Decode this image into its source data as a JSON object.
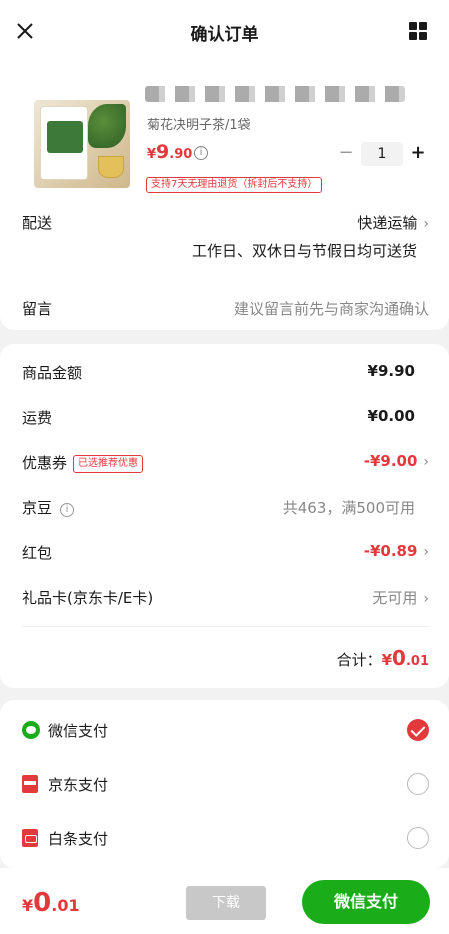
{
  "header": {
    "title": "确认订单"
  },
  "product": {
    "name_visible": "花茶",
    "spec": "菊花决明子茶/1袋",
    "price_symbol": "¥",
    "price_int": "9",
    "price_dec": ".90",
    "quantity": "1",
    "return_policy": "支持7天无理由退货（拆封后不支持）"
  },
  "delivery": {
    "label": "配送",
    "method": "快递运输",
    "note": "工作日、双休日与节假日均可送货"
  },
  "message": {
    "label": "留言",
    "placeholder": "建议留言前先与商家沟通确认"
  },
  "summary": {
    "goods_amount": {
      "label": "商品金额",
      "value": "¥9.90"
    },
    "shipping": {
      "label": "运费",
      "value": "¥0.00"
    },
    "coupon": {
      "label": "优惠券",
      "tag": "已选推荐优惠",
      "value": "-¥9.00"
    },
    "jingdou": {
      "label": "京豆",
      "value": "共463，满500可用"
    },
    "hongbao": {
      "label": "红包",
      "value": "-¥0.89"
    },
    "giftcard": {
      "label": "礼品卡(京东卡/E卡)",
      "value": "无可用"
    },
    "total_label": "合计：",
    "total_symbol": "¥",
    "total_int": "0",
    "total_dec": ".01"
  },
  "payment": {
    "methods": [
      {
        "label": "微信支付",
        "icon": "wechat-pay-icon",
        "selected": true
      },
      {
        "label": "京东支付",
        "icon": "jd-pay-icon",
        "selected": false
      },
      {
        "label": "白条支付",
        "icon": "baitiao-icon",
        "selected": false
      }
    ]
  },
  "bottom": {
    "total_symbol": "¥",
    "total_int": "0",
    "total_dec": ".01",
    "download_label": "下载",
    "pay_label": "微信支付"
  },
  "colors": {
    "accent_red": "#e4393c",
    "wechat_green": "#1aad19"
  }
}
